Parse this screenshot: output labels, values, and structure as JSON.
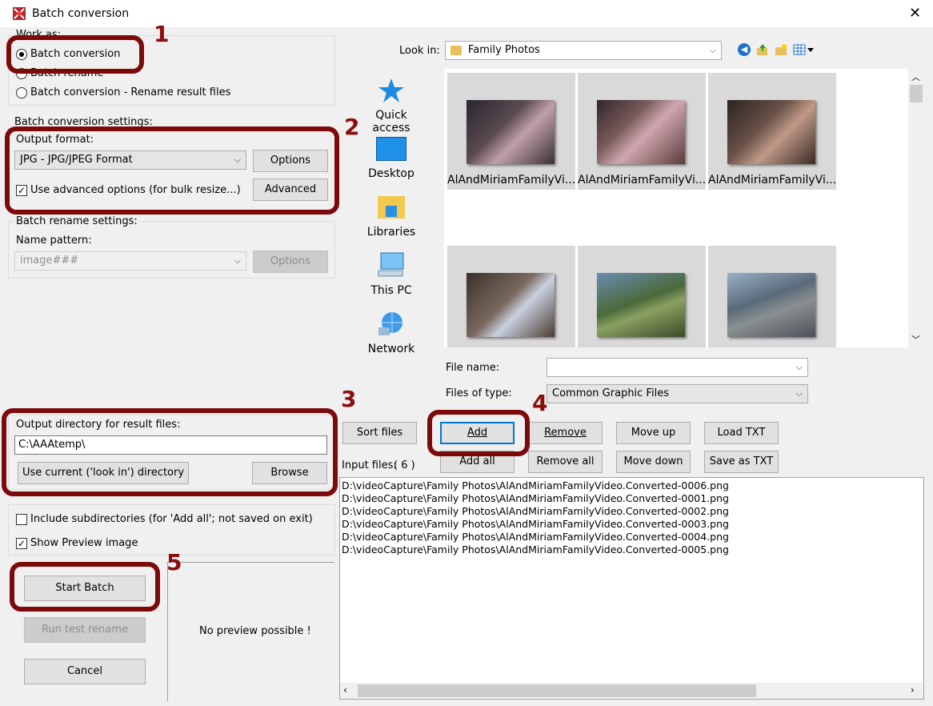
{
  "window": {
    "title": "Batch conversion",
    "close": "✕"
  },
  "work_as": {
    "legend": "Work as:",
    "options": [
      "Batch conversion",
      "Batch rename",
      "Batch conversion - Rename result files"
    ]
  },
  "conversion_settings": {
    "legend": "Batch conversion settings:",
    "output_format_label": "Output format:",
    "output_format_value": "JPG - JPG/JPEG Format",
    "options_button": "Options",
    "advanced_checkbox": "Use advanced options (for bulk resize...)",
    "advanced_button": "Advanced"
  },
  "rename_settings": {
    "legend": "Batch rename settings:",
    "name_pattern_label": "Name pattern:",
    "name_pattern_value": "image###",
    "options_button": "Options"
  },
  "output_dir": {
    "label": "Output directory for result files:",
    "value": "C:\\AAAtemp\\",
    "use_current_button": "Use current ('look in') directory",
    "browse_button": "Browse"
  },
  "checkboxes": {
    "include_subdirs": "Include subdirectories (for 'Add all'; not saved on exit)",
    "show_preview": "Show Preview image"
  },
  "actions": {
    "start_batch": "Start Batch",
    "run_test_rename": "Run test rename",
    "cancel": "Cancel"
  },
  "preview": {
    "text": "No preview possible !"
  },
  "browser": {
    "look_in_label": "Look in:",
    "look_in_value": "Family Photos",
    "places": [
      "Quick access",
      "Desktop",
      "Libraries",
      "This PC",
      "Network"
    ],
    "thumbnails": [
      "AlAndMiriamFamilyVi...",
      "AlAndMiriamFamilyVi...",
      "AlAndMiriamFamilyVi...",
      "",
      "",
      ""
    ],
    "file_name_label": "File name:",
    "file_name_value": "",
    "file_type_label": "Files of type:",
    "file_type_value": "Common Graphic Files"
  },
  "file_buttons": {
    "sort_files": "Sort files",
    "add": "Add",
    "remove": "Remove",
    "move_up": "Move up",
    "load_txt": "Load TXT",
    "add_all": "Add all",
    "remove_all": "Remove all",
    "move_down": "Move down",
    "save_as_txt": "Save as TXT"
  },
  "input_files": {
    "label": "Input files:",
    "count": "( 6 )",
    "files": [
      "D:\\videoCapture\\Family Photos\\AlAndMiriamFamilyVideo.Converted-0006.png",
      "D:\\videoCapture\\Family Photos\\AlAndMiriamFamilyVideo.Converted-0001.png",
      "D:\\videoCapture\\Family Photos\\AlAndMiriamFamilyVideo.Converted-0002.png",
      "D:\\videoCapture\\Family Photos\\AlAndMiriamFamilyVideo.Converted-0003.png",
      "D:\\videoCapture\\Family Photos\\AlAndMiriamFamilyVideo.Converted-0004.png",
      "D:\\videoCapture\\Family Photos\\AlAndMiriamFamilyVideo.Converted-0005.png"
    ]
  },
  "annotations": [
    "1",
    "2",
    "3",
    "4",
    "5"
  ],
  "colors": {
    "annotation": "#7c0a0a",
    "focus": "#0078d7",
    "panel": "#f0f0f0"
  }
}
